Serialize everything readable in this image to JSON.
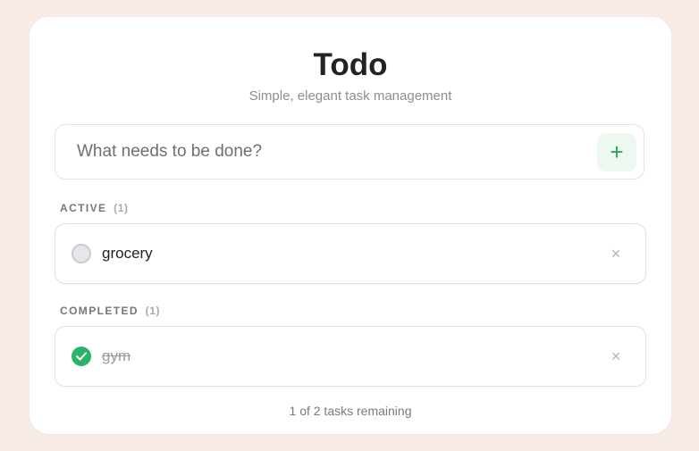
{
  "app": {
    "title": "Todo",
    "subtitle": "Simple, elegant task management"
  },
  "input": {
    "placeholder": "What needs to be done?",
    "value": "",
    "add_label": "+"
  },
  "sections": {
    "active": {
      "label": "ACTIVE",
      "count": "(1)",
      "tasks": [
        {
          "text": "grocery",
          "completed": false,
          "delete_label": "×"
        }
      ]
    },
    "completed": {
      "label": "COMPLETED",
      "count": "(1)",
      "tasks": [
        {
          "text": "gym",
          "completed": true,
          "delete_label": "×"
        }
      ]
    }
  },
  "footer": {
    "remaining_text": "1 of 2 tasks remaining"
  },
  "colors": {
    "background": "#f7ece6",
    "card": "#ffffff",
    "accent_green": "#2bb36a",
    "border": "#f1ddd1"
  },
  "icons": {
    "add": "plus-icon",
    "check": "check-icon",
    "delete": "close-icon"
  }
}
